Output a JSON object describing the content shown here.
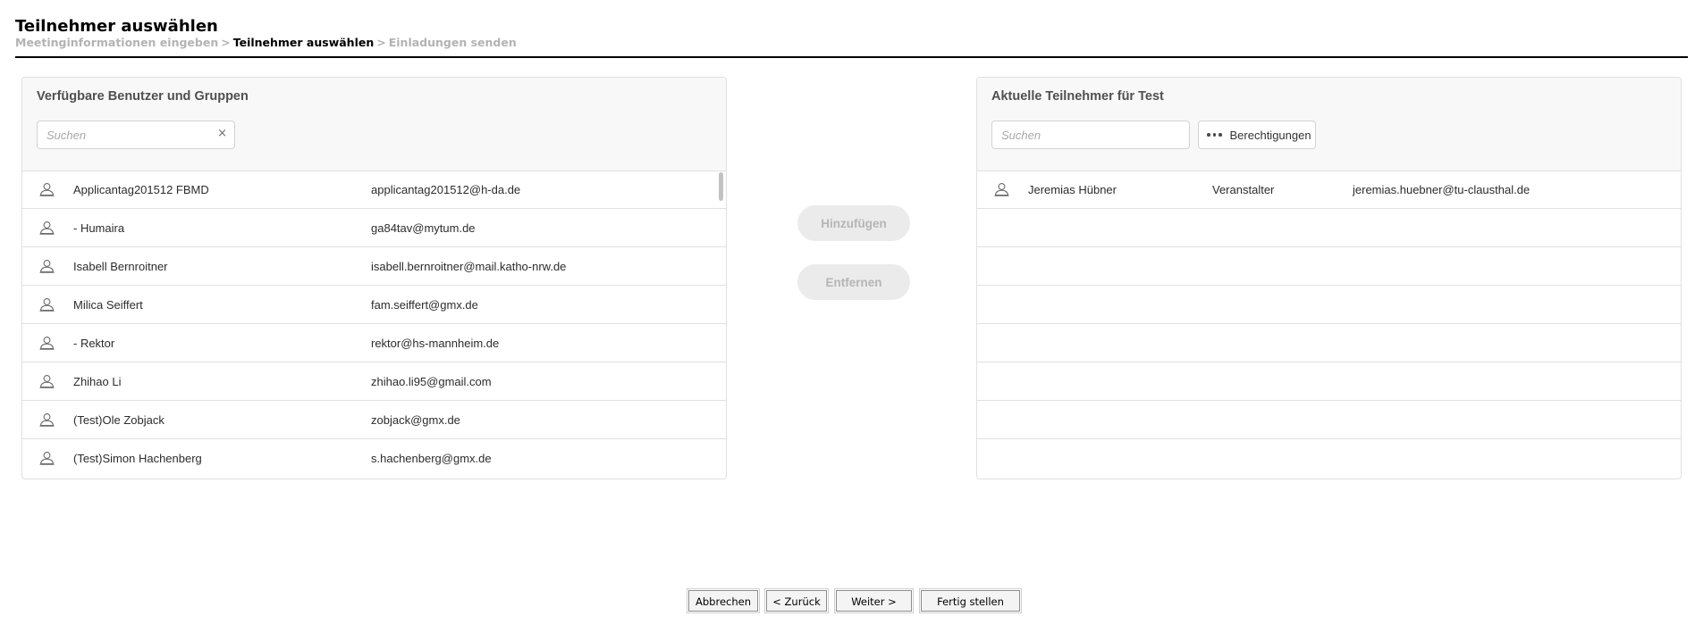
{
  "page": {
    "title": "Teilnehmer auswählen",
    "breadcrumb": {
      "step1": "Meetinginformationen eingeben",
      "step2": "Teilnehmer auswählen",
      "step3": "Einladungen senden",
      "separator": ">"
    }
  },
  "left_panel": {
    "title": "Verfügbare Benutzer und Gruppen",
    "search_placeholder": "Suchen",
    "clear_icon": "×",
    "rows": [
      {
        "name": "Applicantag201512 FBMD",
        "email": "applicantag201512@h-da.de"
      },
      {
        "name": "- Humaira",
        "email": "ga84tav@mytum.de"
      },
      {
        "name": "Isabell Bernroitner",
        "email": "isabell.bernroitner@mail.katho-nrw.de"
      },
      {
        "name": "Milica Seiffert",
        "email": "fam.seiffert@gmx.de"
      },
      {
        "name": "- Rektor",
        "email": "rektor@hs-mannheim.de"
      },
      {
        "name": "Zhihao Li",
        "email": "zhihao.li95@gmail.com"
      },
      {
        "name": "(Test)Ole Zobjack",
        "email": "zobjack@gmx.de"
      },
      {
        "name": "(Test)Simon Hachenberg",
        "email": "s.hachenberg@gmx.de"
      }
    ]
  },
  "actions": {
    "add_label": "Hinzufügen",
    "remove_label": "Entfernen"
  },
  "right_panel": {
    "title": "Aktuelle Teilnehmer für Test",
    "search_placeholder": "Suchen",
    "permissions_label": "Berechtigungen",
    "rows": [
      {
        "name": "Jeremias Hübner",
        "role": "Veranstalter",
        "email": "jeremias.huebner@tu-clausthal.de"
      },
      {
        "name": "",
        "role": "",
        "email": ""
      },
      {
        "name": "",
        "role": "",
        "email": ""
      },
      {
        "name": "",
        "role": "",
        "email": ""
      },
      {
        "name": "",
        "role": "",
        "email": ""
      },
      {
        "name": "",
        "role": "",
        "email": ""
      },
      {
        "name": "",
        "role": "",
        "email": ""
      },
      {
        "name": "",
        "role": "",
        "email": ""
      }
    ]
  },
  "footer": {
    "cancel_label": "Abbrechen",
    "back_label": "< Zurück",
    "next_label": "Weiter >",
    "finish_label": "Fertig stellen"
  },
  "icons": {
    "user": "user-icon",
    "more": "more-dots-icon",
    "clear": "clear-icon"
  }
}
